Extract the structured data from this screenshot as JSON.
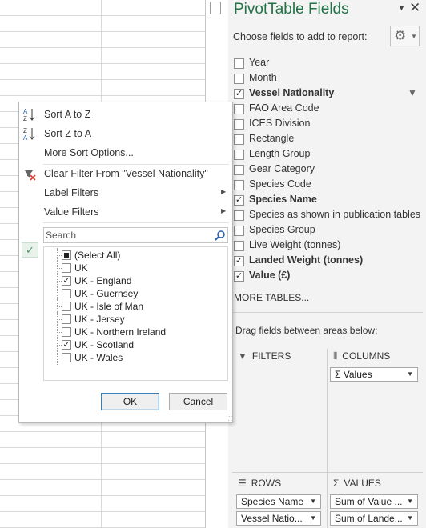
{
  "pane": {
    "title": "PivotTable Fields",
    "close_icon": "✕",
    "choose_label": "Choose fields to add to report:",
    "settings_icon": "gear-icon",
    "more_tables": "MORE TABLES...",
    "drag_label": "Drag fields between areas below:",
    "fields": [
      {
        "label": "Year",
        "checked": false
      },
      {
        "label": "Month",
        "checked": false
      },
      {
        "label": "Vessel Nationality",
        "checked": true,
        "filtered": true
      },
      {
        "label": "FAO Area Code",
        "checked": false
      },
      {
        "label": "ICES Division",
        "checked": false
      },
      {
        "label": "Rectangle",
        "checked": false
      },
      {
        "label": "Length Group",
        "checked": false
      },
      {
        "label": "Gear Category",
        "checked": false
      },
      {
        "label": "Species Code",
        "checked": false
      },
      {
        "label": "Species Name",
        "checked": true
      },
      {
        "label": "Species as shown in publication tables",
        "checked": false
      },
      {
        "label": "Species Group",
        "checked": false
      },
      {
        "label": "Live Weight (tonnes)",
        "checked": false
      },
      {
        "label": "Landed Weight (tonnes)",
        "checked": true
      },
      {
        "label": "Value (£)",
        "checked": true
      }
    ],
    "areas": {
      "filters": {
        "label": "FILTERS"
      },
      "columns": {
        "label": "COLUMNS",
        "items": [
          "Values"
        ]
      },
      "rows": {
        "label": "ROWS",
        "items": [
          "Species Name",
          "Vessel Natio..."
        ]
      },
      "values": {
        "label": "VALUES",
        "items": [
          "Sum of Value ...",
          "Sum of Lande..."
        ]
      }
    }
  },
  "dropdown": {
    "sort_az": "Sort A to Z",
    "sort_za": "Sort Z to A",
    "more_sort": "More Sort Options...",
    "clear_filter": "Clear Filter From \"Vessel Nationality\"",
    "label_filters": "Label Filters",
    "value_filters": "Value Filters",
    "search_placeholder": "Search",
    "items": [
      {
        "label": "(Select All)",
        "state": "mixed"
      },
      {
        "label": "UK",
        "state": "unchecked"
      },
      {
        "label": "UK - England",
        "state": "checked"
      },
      {
        "label": "UK - Guernsey",
        "state": "unchecked"
      },
      {
        "label": "UK - Isle of Man",
        "state": "unchecked"
      },
      {
        "label": "UK - Jersey",
        "state": "unchecked"
      },
      {
        "label": "UK - Northern Ireland",
        "state": "unchecked"
      },
      {
        "label": "UK - Scotland",
        "state": "checked"
      },
      {
        "label": "UK - Wales",
        "state": "unchecked"
      }
    ],
    "ok_label": "OK",
    "cancel_label": "Cancel"
  }
}
